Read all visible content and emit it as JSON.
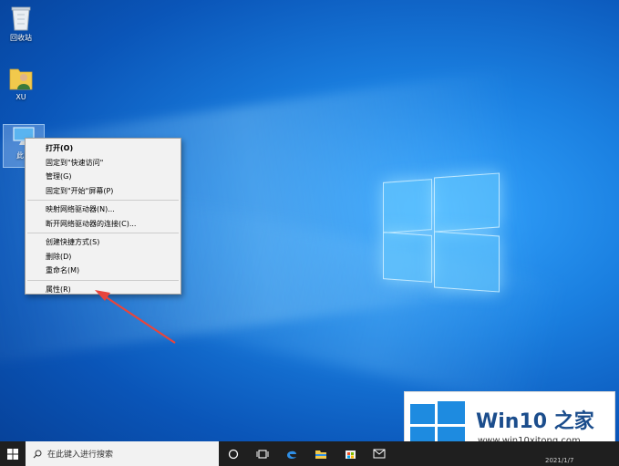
{
  "desktop": {
    "icons": [
      {
        "label": "回收站",
        "icon": "recycle-bin-icon"
      },
      {
        "label": "XU",
        "icon": "user-folder-icon"
      },
      {
        "label": "此电",
        "icon": "this-pc-icon"
      }
    ]
  },
  "context_menu": {
    "items": [
      {
        "label": "打开(O)",
        "bold": true
      },
      {
        "label": "固定到\"快速访问\""
      },
      {
        "label": "管理(G)"
      },
      {
        "label": "固定到\"开始\"屏幕(P)"
      },
      {
        "label": "映射网络驱动器(N)..."
      },
      {
        "label": "断开网络驱动器的连接(C)..."
      },
      {
        "label": "创建快捷方式(S)"
      },
      {
        "label": "删除(D)"
      },
      {
        "label": "重命名(M)"
      },
      {
        "label": "属性(R)"
      }
    ]
  },
  "taskbar": {
    "search_placeholder": "在此键入进行搜索",
    "icons": [
      "start-icon",
      "search-icon",
      "cortana-icon",
      "task-view-icon",
      "edge-icon",
      "file-explorer-icon",
      "store-icon",
      "mail-icon"
    ]
  },
  "watermark": {
    "title": "Win10",
    "title_cn": "之家",
    "url": "www.win10xitong.com"
  },
  "clock_hint": "2021/1/7",
  "colors": {
    "arrow": "#e8453c",
    "win_blue": "#1e8be0",
    "taskbar": "#1f1f1f"
  }
}
